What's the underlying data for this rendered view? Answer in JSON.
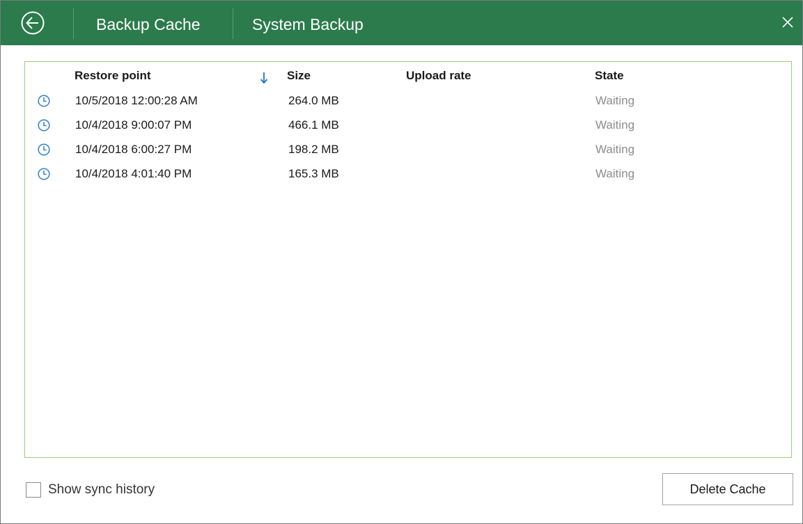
{
  "window": {
    "titlebar": {
      "back_icon": "back-arrow-circle-icon",
      "breadcrumb": [
        "Backup Cache",
        "System Backup"
      ],
      "close_icon": "close-icon",
      "background_color": "#2b7b4c"
    }
  },
  "list": {
    "columns": [
      "Restore point",
      "Size",
      "Upload rate",
      "State"
    ],
    "sort_icon": "sort-descending-arrow-icon",
    "row_icon": "clock-icon",
    "rows": [
      {
        "restore_point": "10/5/2018 12:00:28 AM",
        "size": "264.0 MB",
        "upload_rate": "",
        "state": "Waiting"
      },
      {
        "restore_point": "10/4/2018 9:00:07 PM",
        "size": "466.1 MB",
        "upload_rate": "",
        "state": "Waiting"
      },
      {
        "restore_point": "10/4/2018 6:00:27 PM",
        "size": "198.2 MB",
        "upload_rate": "",
        "state": "Waiting"
      },
      {
        "restore_point": "10/4/2018 4:01:40 PM",
        "size": "165.3 MB",
        "upload_rate": "",
        "state": "Waiting"
      }
    ],
    "border_color": "#99cc7a"
  },
  "footer": {
    "show_sync_history_label": "Show sync history",
    "show_sync_history_checked": false,
    "delete_button_label": "Delete Cache"
  }
}
